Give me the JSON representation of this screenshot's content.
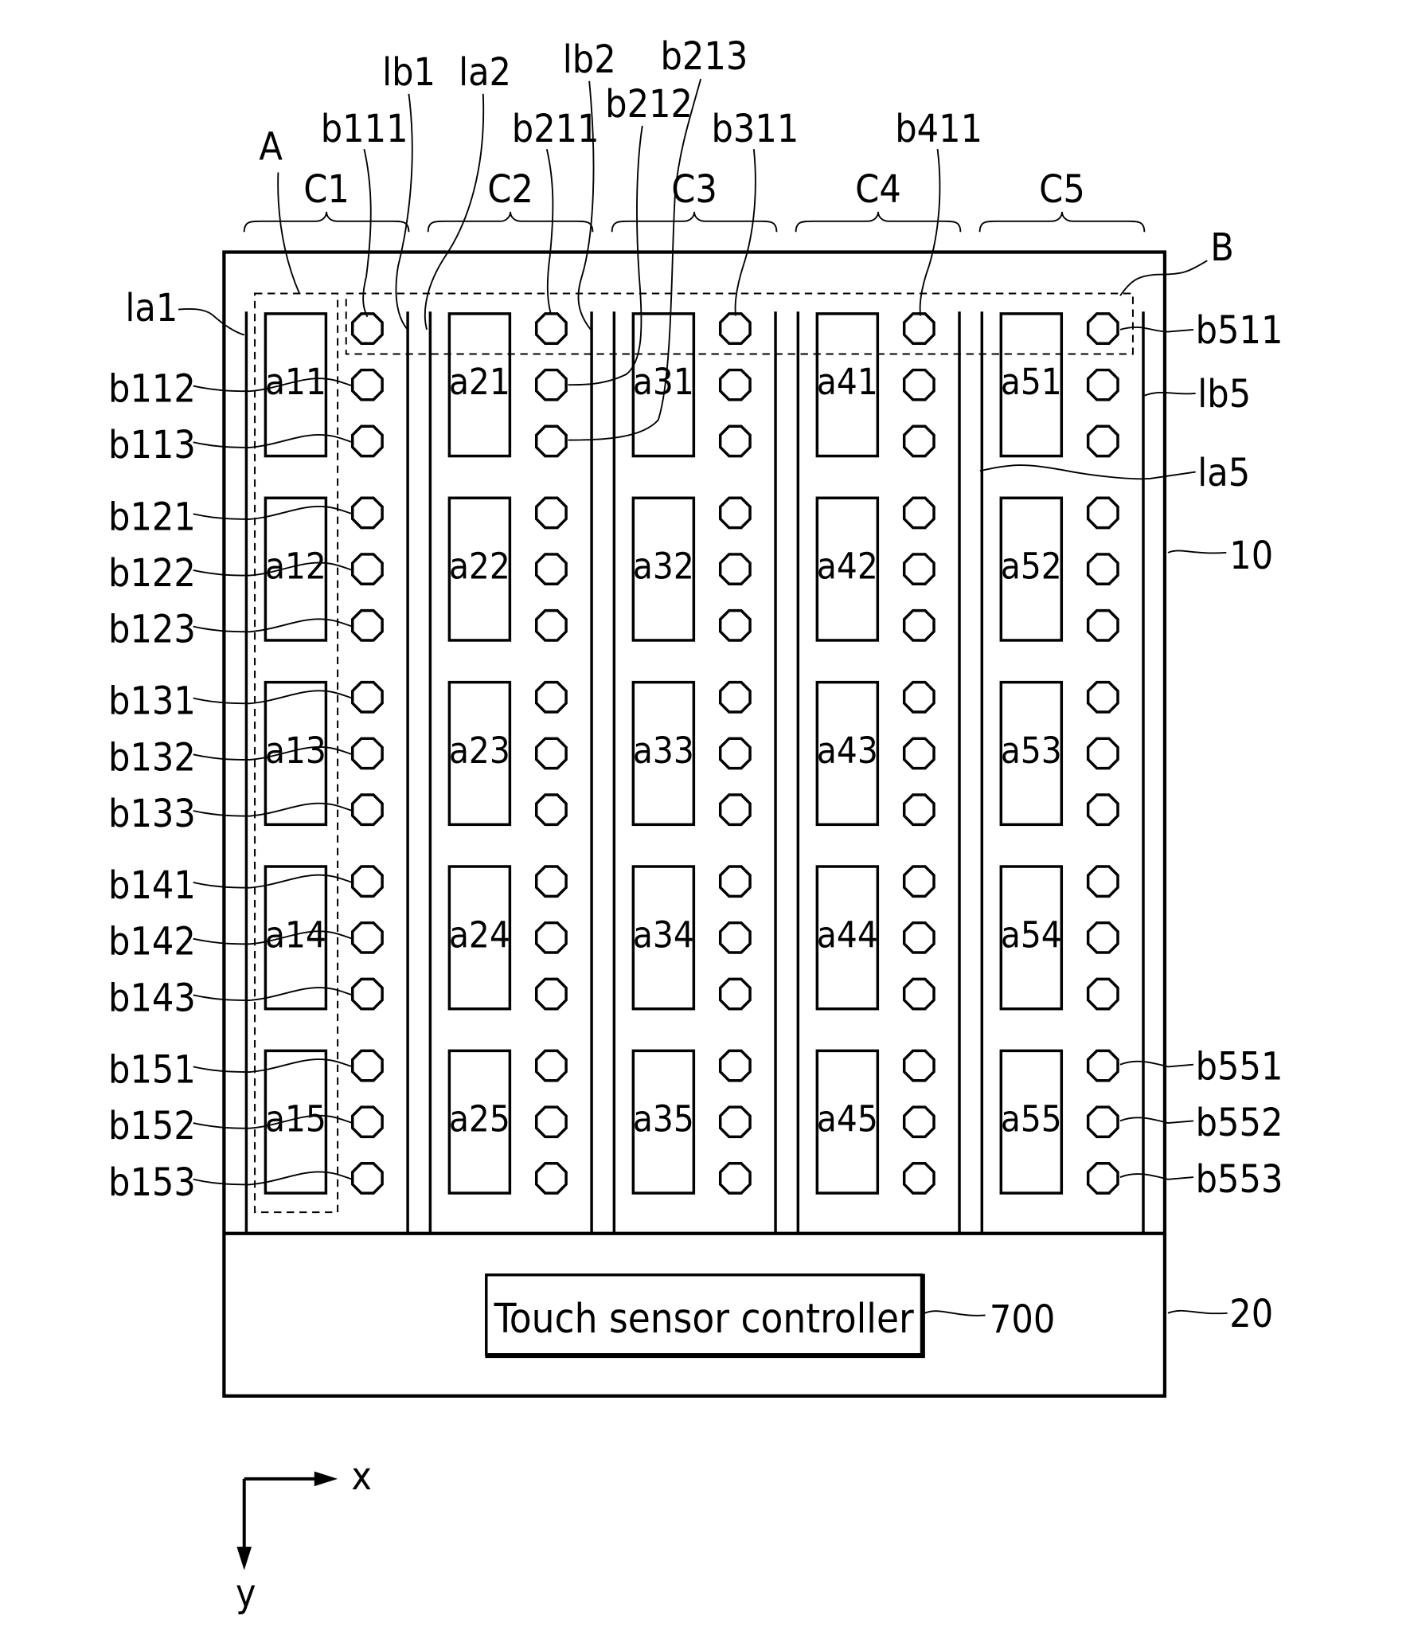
{
  "figure": {
    "colors": {
      "ink": "#000000",
      "background": "#ffffff"
    },
    "groups": {
      "A": "A",
      "B": "B"
    },
    "columns": [
      "C1",
      "C2",
      "C3",
      "C4",
      "C5"
    ],
    "cells": [
      [
        "a11",
        "a12",
        "a13",
        "a14",
        "a15"
      ],
      [
        "a21",
        "a22",
        "a23",
        "a24",
        "a25"
      ],
      [
        "a31",
        "a32",
        "a33",
        "a34",
        "a35"
      ],
      [
        "a41",
        "a42",
        "a43",
        "a44",
        "a45"
      ],
      [
        "a51",
        "a52",
        "a53",
        "a54",
        "a55"
      ]
    ],
    "top_labels": {
      "b111": "b111",
      "lb1": "lb1",
      "la2": "la2",
      "b211": "b211",
      "lb2": "lb2",
      "b212": "b212",
      "b213": "b213",
      "b311": "b311",
      "b411": "b411"
    },
    "left_labels": [
      "la1",
      "b112",
      "b113",
      "b121",
      "b122",
      "b123",
      "b131",
      "b132",
      "b133",
      "b141",
      "b142",
      "b143",
      "b151",
      "b152",
      "b153"
    ],
    "right_labels": {
      "b511": "b511",
      "lb5": "lb5",
      "la5": "la5",
      "panel": "10",
      "b551": "b551",
      "b552": "b552",
      "b553": "b553",
      "controller_region": "20"
    },
    "controller": {
      "label": "Touch sensor controller",
      "ref": "700"
    },
    "axes": {
      "x": "x",
      "y": "y"
    }
  }
}
